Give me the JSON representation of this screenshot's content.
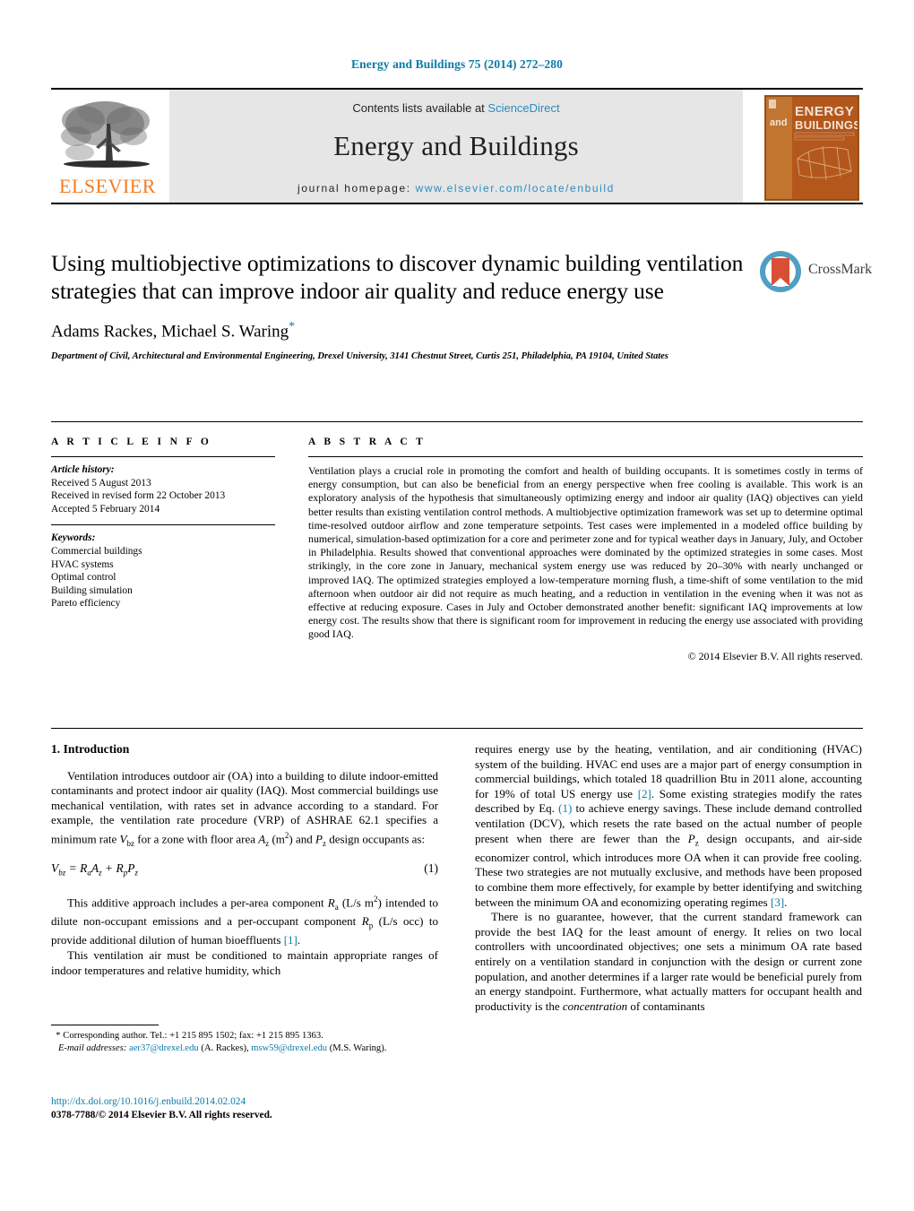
{
  "running_head": "Energy and Buildings 75 (2014) 272–280",
  "masthead": {
    "publisher_name": "ELSEVIER",
    "contents_prefix": "Contents lists available at ",
    "contents_link": "ScienceDirect",
    "journal_title": "Energy and Buildings",
    "homepage_prefix": "journal homepage:",
    "homepage_url": "www.elsevier.com/locate/enbuild",
    "cover": {
      "line1": "ENERGY",
      "line2": "and",
      "line3": "BUILDINGS"
    }
  },
  "article": {
    "title": "Using multiobjective optimizations to discover dynamic building ventilation strategies that can improve indoor air quality and reduce energy use",
    "authors": "Adams Rackes, Michael S. Waring",
    "corresponding_marker": "*",
    "affiliation": "Department of Civil, Architectural and Environmental Engineering, Drexel University, 3141 Chestnut Street, Curtis 251, Philadelphia, PA 19104, United States",
    "crossmark_label": "CrossMark"
  },
  "article_info": {
    "heading": "A R T I C L E    I N F O",
    "history_label": "Article history:",
    "history": [
      "Received 5 August 2013",
      "Received in revised form 22 October 2013",
      "Accepted 5 February 2014"
    ],
    "keywords_label": "Keywords:",
    "keywords": [
      "Commercial buildings",
      "HVAC systems",
      "Optimal control",
      "Building simulation",
      "Pareto efficiency"
    ]
  },
  "abstract": {
    "heading": "A B S T R A C T",
    "text": "Ventilation plays a crucial role in promoting the comfort and health of building occupants. It is sometimes costly in terms of energy consumption, but can also be beneficial from an energy perspective when free cooling is available. This work is an exploratory analysis of the hypothesis that simultaneously optimizing energy and indoor air quality (IAQ) objectives can yield better results than existing ventilation control methods. A multiobjective optimization framework was set up to determine optimal time-resolved outdoor airflow and zone temperature setpoints. Test cases were implemented in a modeled office building by numerical, simulation-based optimization for a core and perimeter zone and for typical weather days in January, July, and October in Philadelphia. Results showed that conventional approaches were dominated by the optimized strategies in some cases. Most strikingly, in the core zone in January, mechanical system energy use was reduced by 20–30% with nearly unchanged or improved IAQ. The optimized strategies employed a low-temperature morning flush, a time-shift of some ventilation to the mid afternoon when outdoor air did not require as much heating, and a reduction in ventilation in the evening when it was not as effective at reducing exposure. Cases in July and October demonstrated another benefit: significant IAQ improvements at low energy cost. The results show that there is significant room for improvement in reducing the energy use associated with providing good IAQ.",
    "copyright": "© 2014 Elsevier B.V. All rights reserved."
  },
  "body": {
    "section_number_title": "1.  Introduction",
    "left_para_1": "Ventilation introduces outdoor air (OA) into a building to dilute indoor-emitted contaminants and protect indoor air quality (IAQ). Most commercial buildings use mechanical ventilation, with rates set in advance according to a standard. For example, the ventilation rate procedure (VRP) of ASHRAE 62.1 specifies a minimum rate",
    "left_para_1_tail": "for a zone with floor area",
    "equation_number": "(1)",
    "left_para_2_a": "This additive approach includes a per-area component",
    "left_para_2_b": "intended to dilute non-occupant emissions and a per-occupant component",
    "left_para_2_c": "to provide additional dilution of human bioeffluents",
    "ref_1": "[1]",
    "left_para_3": "This ventilation air must be conditioned to maintain appropriate ranges of indoor temperatures and relative humidity, which",
    "right_para_1_a": "requires energy use by the heating, ventilation, and air conditioning (HVAC) system of the building. HVAC end uses are a major part of energy consumption in commercial buildings, which totaled 18 quadrillion Btu in 2011 alone, accounting for 19% of total US energy use",
    "ref_2": "[2]",
    "right_para_1_b": ". Some existing strategies modify the rates described by Eq.",
    "ref_eq1": "(1)",
    "right_para_1_c": "to achieve energy savings. These include demand controlled ventilation (DCV), which resets the rate based on the actual number of people present when there are fewer than the",
    "right_para_1_d": "design occupants, and air-side economizer control, which introduces more OA when it can provide free cooling. These two strategies are not mutually exclusive, and methods have been proposed to combine them more effectively, for example by better identifying and switching between the minimum OA and economizing operating regimes",
    "ref_3": "[3]",
    "right_para_2_a": "There is no guarantee, however, that the current standard framework can provide the best IAQ for the least amount of energy. It relies on two local controllers with uncoordinated objectives; one sets a minimum OA rate based entirely on a ventilation standard in conjunction with the design or current zone population, and another determines if a larger rate would be beneficial purely from an energy standpoint. Furthermore, what actually matters for occupant health and productivity is the",
    "right_para_2_italic": "concentration",
    "right_para_2_b": "of contaminants"
  },
  "footnote": {
    "marker": "*",
    "corresponding": "Corresponding author. Tel.: +1 215 895 1502; fax: +1 215 895 1363.",
    "email_label": "E-mail addresses:",
    "email_1": "aer37@drexel.edu",
    "email_1_owner": "(A. Rackes),",
    "email_2": "msw59@drexel.edu",
    "email_2_owner": "(M.S. Waring)."
  },
  "doi": {
    "url": "http://dx.doi.org/10.1016/j.enbuild.2014.02.024",
    "issn": "0378-7788/© 2014 Elsevier B.V. All rights reserved."
  },
  "colors": {
    "link": "#0b7ba8",
    "sciencedirect": "#2b8bbf",
    "elsevier_orange": "#f57c20",
    "panel_gray": "#e6e6e6"
  }
}
